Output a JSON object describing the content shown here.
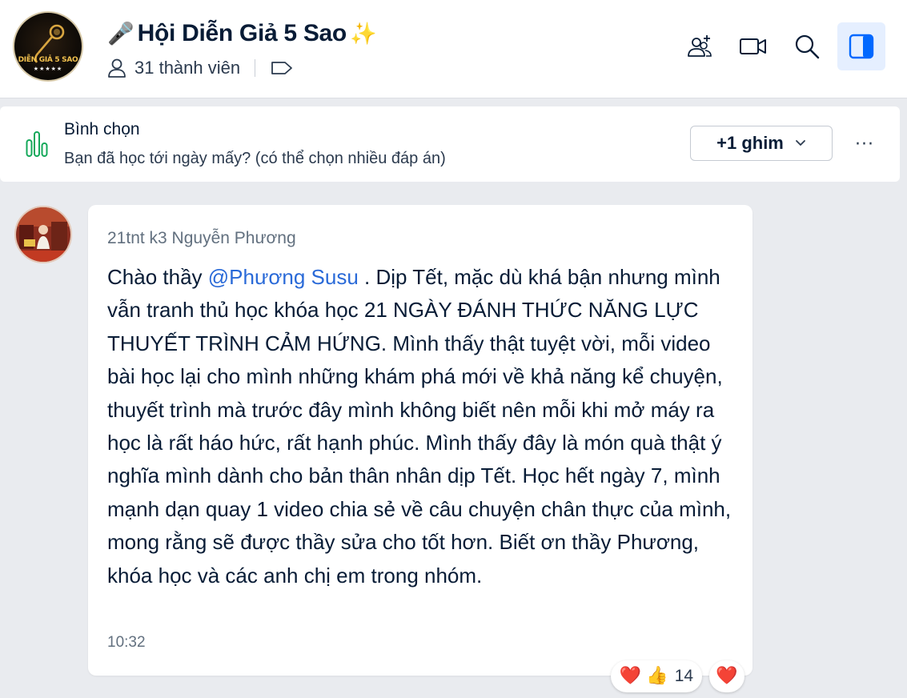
{
  "header": {
    "title_emoji_left": "🎤",
    "title": "Hội Diễn Giả 5 Sao",
    "title_emoji_right": "✨",
    "members": "31 thành viên",
    "avatar_text": "DIỄN GIẢ 5 SAO",
    "avatar_stars": "★★★★★",
    "icons": [
      "add-member-icon",
      "video-call-icon",
      "search-icon",
      "sidebar-toggle-icon"
    ]
  },
  "pinned": {
    "title": "Bình chọn",
    "question": "Bạn đã học tới ngày mấy? (có thể chọn nhiều đáp án)",
    "pin_button": "+1 ghim",
    "more": "···"
  },
  "message": {
    "sender": "21tnt k3 Nguyễn Phương",
    "greeting": "Chào thầy ",
    "mention": "@Phương Susu",
    "body": " . Dịp Tết, mặc dù khá bận nhưng mình vẫn tranh thủ học khóa học 21 NGÀY ĐÁNH THỨC NĂNG LỰC THUYẾT TRÌNH CẢM HỨNG. Mình thấy thật tuyệt vời, mỗi video bài học lại cho mình những khám phá mới về khả năng kể chuyện, thuyết trình mà trước đây mình không biết nên mỗi khi mở máy ra học là rất háo hức, rất hạnh phúc. Mình thấy đây là món quà thật ý nghĩa mình dành cho bản thân nhân dịp Tết. Học hết ngày 7, mình mạnh dạn quay 1 video chia sẻ về câu chuyện chân thực của mình, mong rằng sẽ được thầy sửa cho tốt hơn. Biết ơn thầy Phương, khóa học và các anh chị em trong nhóm.",
    "time": "10:32",
    "reactions": {
      "heart": "❤️",
      "like": "👍",
      "count": "14"
    },
    "react_button": "❤️"
  },
  "colors": {
    "accent": "#0068ff",
    "mention": "#2a6ad8",
    "poll_green": "#14a85a",
    "background": "#e9ebef"
  }
}
